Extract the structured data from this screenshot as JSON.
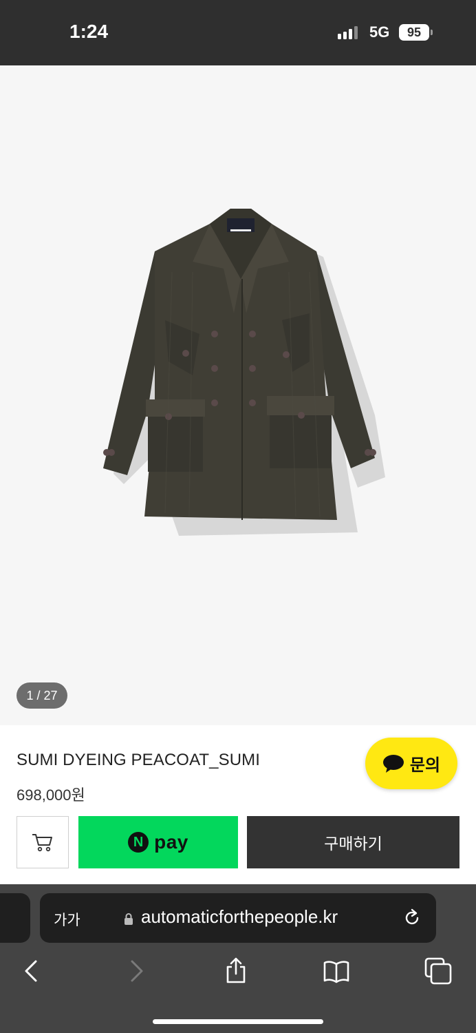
{
  "status_bar": {
    "time": "1:24",
    "network": "5G",
    "battery": "95"
  },
  "gallery": {
    "counter": "1 / 27"
  },
  "product": {
    "title": "SUMI DYEING PEACOAT_SUMI",
    "price": "698,000원"
  },
  "inquiry": {
    "label": "문의",
    "color": "#ffe812"
  },
  "actions": {
    "npay_n": "N",
    "npay_label": "pay",
    "buy_label": "구매하기",
    "npay_color": "#03d75c"
  },
  "browser": {
    "text_size_label": "가가",
    "url": "automaticforthepeople.kr"
  },
  "icons": [
    "signal-icon",
    "battery-icon",
    "chat-bubble-icon",
    "cart-icon",
    "lock-icon",
    "reload-icon",
    "back-icon",
    "forward-icon",
    "share-icon",
    "bookmarks-icon",
    "tabs-icon"
  ]
}
